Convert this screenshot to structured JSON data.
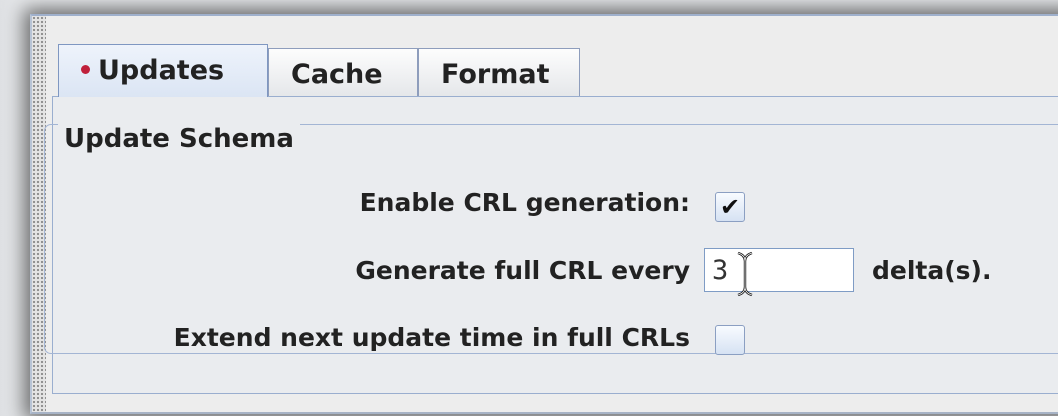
{
  "tabs": [
    {
      "label": "Updates",
      "active": true
    },
    {
      "label": "Cache",
      "active": false
    },
    {
      "label": "Format",
      "active": false
    }
  ],
  "group": {
    "title": "Update Schema",
    "enable_crl": {
      "label": "Enable CRL generation:",
      "checked": true,
      "glyph": "✔"
    },
    "full_crl": {
      "label": "Generate full CRL every",
      "value": "3",
      "suffix": "delta(s)."
    },
    "extend_next": {
      "label": "Extend next update time in full CRLs",
      "checked": false
    }
  },
  "colors": {
    "accent": "#7f97c1",
    "active_tab_dot": "#c0203b",
    "panel_bg": "#eaecef"
  }
}
